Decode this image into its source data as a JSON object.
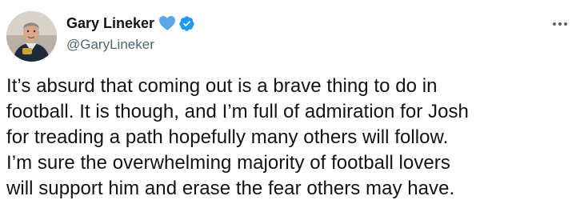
{
  "tweet": {
    "author": {
      "display_name": "Gary Lineker",
      "handle": "@GaryLineker",
      "badges": [
        "blue-heart-icon",
        "verified-badge-icon"
      ]
    },
    "more_icon": "more-options-icon",
    "text_lines": [
      "It’s absurd that coming out is a brave thing to do in",
      "football. It is though, and I’m full of admiration for Josh",
      "for treading a path hopefully many others will follow.",
      "I’m sure the overwhelming majority of football lovers",
      "will support him and erase the fear others may have."
    ]
  },
  "colors": {
    "text_primary": "#0f1419",
    "text_secondary": "#536471",
    "verified_blue": "#1d9bf0",
    "heart_blue": "#5aa9e6"
  }
}
